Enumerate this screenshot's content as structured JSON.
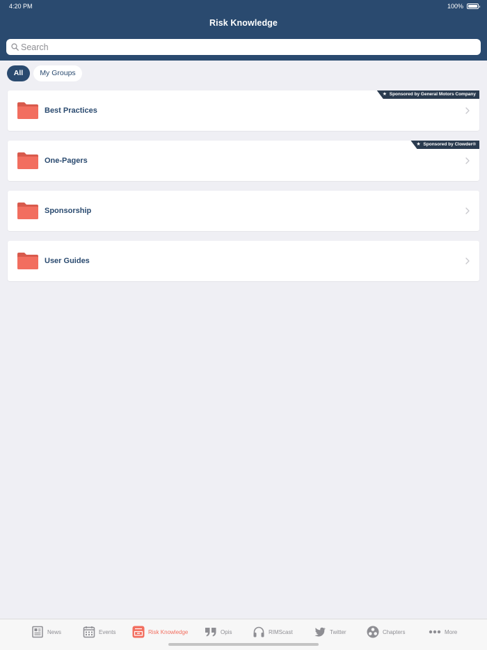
{
  "status_bar": {
    "time": "4:20 PM",
    "battery": "100%"
  },
  "header": {
    "title": "Risk Knowledge"
  },
  "search": {
    "placeholder": "Search"
  },
  "segments": [
    {
      "label": "All",
      "selected": true
    },
    {
      "label": "My Groups",
      "selected": false
    }
  ],
  "folders": [
    {
      "label": "Best Practices",
      "sponsor": "Sponsored by General Motors Company"
    },
    {
      "label": "One-Pagers",
      "sponsor": "Sponsored by Clowder®"
    },
    {
      "label": "Sponsorship"
    },
    {
      "label": "User Guides"
    }
  ],
  "tabs": [
    {
      "label": "News",
      "icon": "news-icon"
    },
    {
      "label": "Events",
      "icon": "calendar-icon"
    },
    {
      "label": "Risk Knowledge",
      "icon": "risk-knowledge-icon",
      "active": true
    },
    {
      "label": "Opis",
      "icon": "quote-icon"
    },
    {
      "label": "RIMScast",
      "icon": "headphones-icon"
    },
    {
      "label": "Twitter",
      "icon": "twitter-icon"
    },
    {
      "label": "Chapters",
      "icon": "chapters-icon"
    },
    {
      "label": "More",
      "icon": "more-icon"
    }
  ],
  "colors": {
    "header": "#2a4a6f",
    "folder": "#f26e5f",
    "active_tab": "#f26e5f",
    "sponsor_badge": "#2a3b4f"
  }
}
